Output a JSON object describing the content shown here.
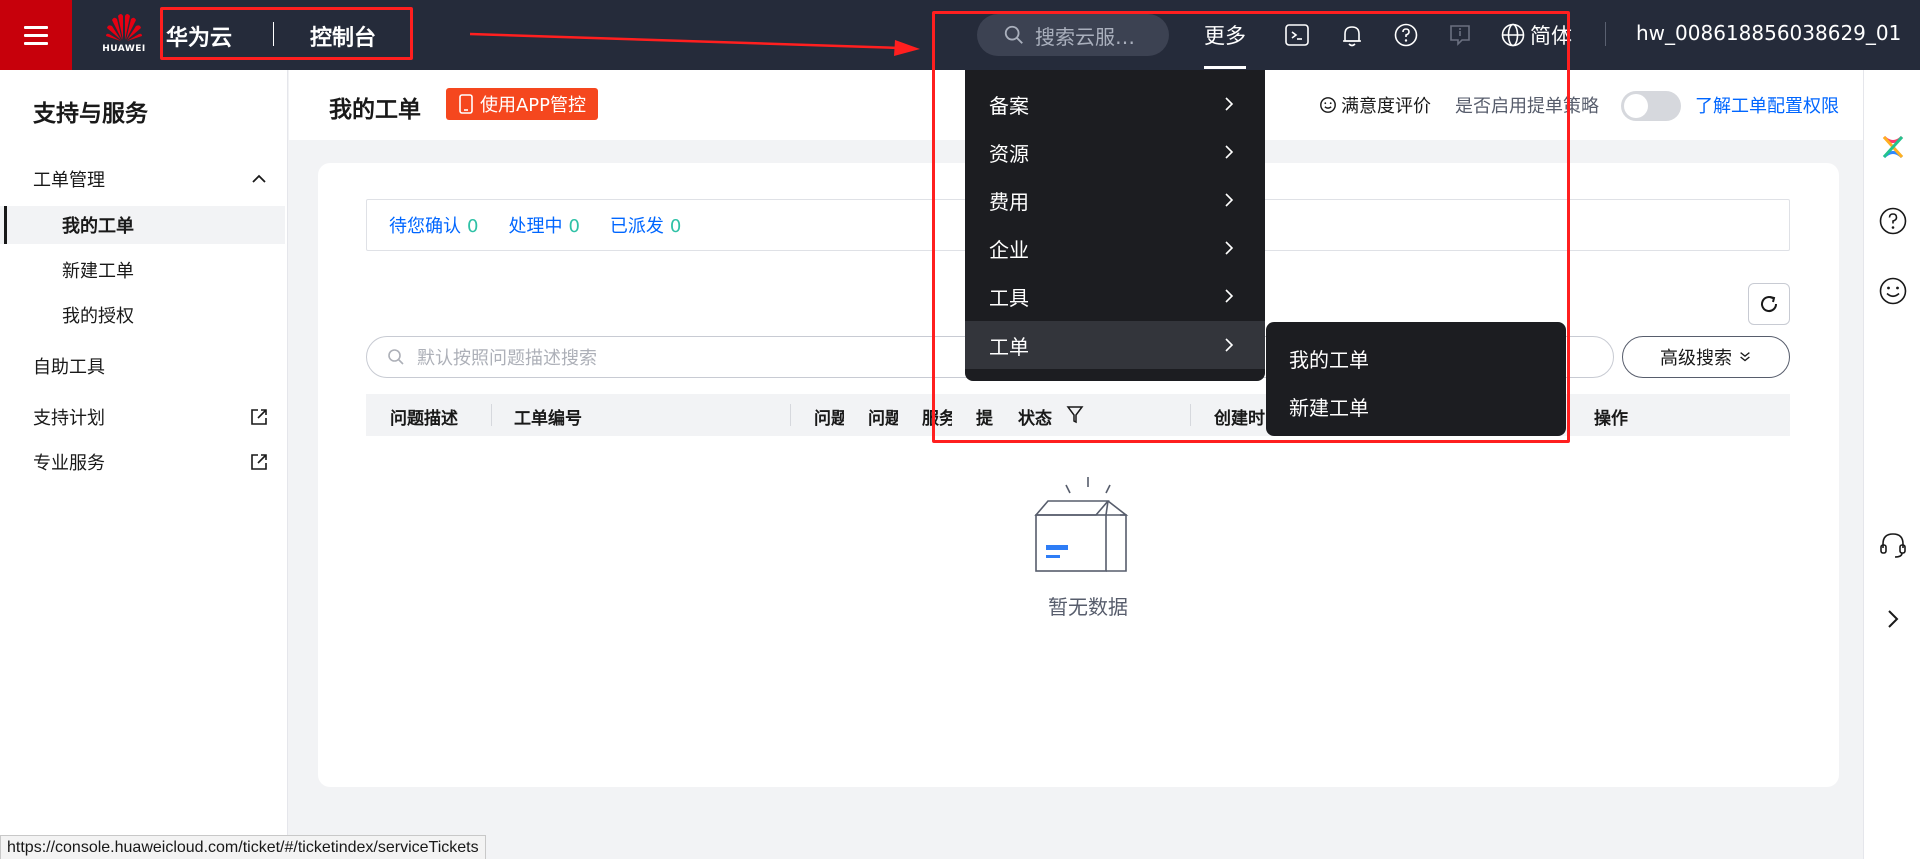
{
  "topbar": {
    "logo_text": "HUAWEI",
    "brand": "华为云",
    "console": "控制台",
    "search_placeholder": "搜索云服…",
    "more": "更多",
    "language": "简体",
    "username": "hw_008618856038629_01",
    "icons": [
      "terminal-icon",
      "bell-icon",
      "help-icon",
      "feedback-icon",
      "globe-icon"
    ]
  },
  "dropdown": {
    "items": [
      {
        "label": "备案"
      },
      {
        "label": "资源"
      },
      {
        "label": "费用"
      },
      {
        "label": "企业"
      },
      {
        "label": "工具"
      },
      {
        "label": "工单"
      }
    ],
    "submenu": [
      {
        "label": "我的工单"
      },
      {
        "label": "新建工单"
      }
    ]
  },
  "sidebar": {
    "title": "支持与服务",
    "items": [
      {
        "label": "工单管理"
      },
      {
        "label": "我的工单"
      },
      {
        "label": "新建工单"
      },
      {
        "label": "我的授权"
      },
      {
        "label": "自助工具"
      },
      {
        "label": "支持计划"
      },
      {
        "label": "专业服务"
      }
    ]
  },
  "header": {
    "title": "我的工单",
    "app_button": "使用APP管控",
    "satisfaction": "满意度评价",
    "enable_policy": "是否启用提单策略",
    "permission_link": "了解工单配置权限"
  },
  "status_tabs": [
    {
      "label": "待您确认",
      "count": "0"
    },
    {
      "label": "处理中",
      "count": "0"
    },
    {
      "label": "已派发",
      "count": "0"
    }
  ],
  "search": {
    "placeholder": "默认按照问题描述搜索",
    "advanced": "高级搜索"
  },
  "table": {
    "columns": [
      "问题描述",
      "工单编号",
      "问题",
      "问题",
      "服务",
      "提",
      "状态",
      "创建时",
      "操作"
    ]
  },
  "empty_text": "暂无数据",
  "status_url": "https://console.huaweicloud.com/ticket/#/ticketindex/serviceTickets",
  "colors": {
    "topbar": "#252b3a",
    "brand_red": "#c7000b",
    "link_blue": "#0066ff",
    "count_green": "#2fc1a6",
    "annotation_red": "#ff1f1f"
  }
}
